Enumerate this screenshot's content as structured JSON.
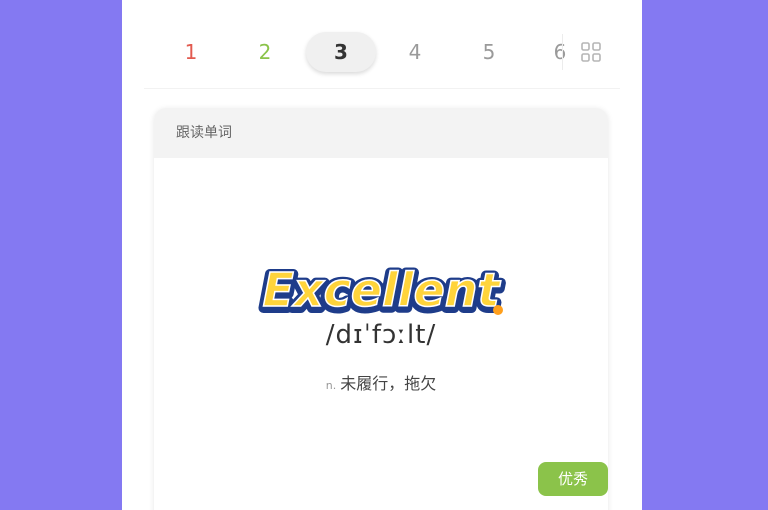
{
  "tabs": {
    "items": [
      {
        "label": "1",
        "status": "wrong"
      },
      {
        "label": "2",
        "status": "correct"
      },
      {
        "label": "3",
        "status": "active"
      },
      {
        "label": "4",
        "status": "pending"
      },
      {
        "label": "5",
        "status": "pending"
      },
      {
        "label": "6",
        "status": "pending"
      }
    ],
    "grid_icon": "grid-icon"
  },
  "card": {
    "header": "跟读单词",
    "result_word": "Excellent",
    "phonetic": "/dɪˈfɔːlt/",
    "pos": "n.",
    "meaning": "未履行，拖欠",
    "badge": "优秀"
  },
  "colors": {
    "background": "#8479f2",
    "wrong": "#e25a4f",
    "correct": "#8bc34a",
    "badge": "#8bc34a",
    "excellent_fill": "#ffd43b",
    "excellent_stroke": "#2b4fa8"
  }
}
